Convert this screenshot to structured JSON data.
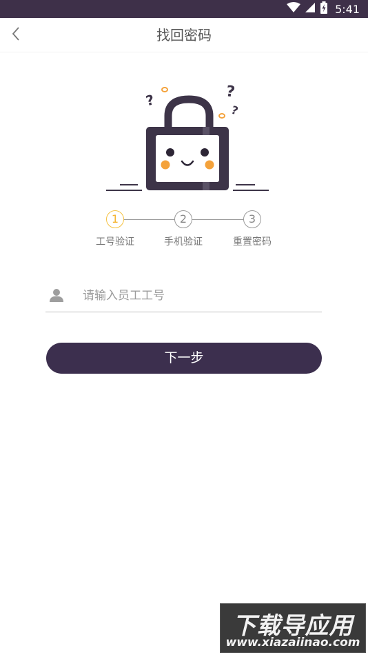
{
  "status_bar": {
    "time": "5:41"
  },
  "header": {
    "title": "找回密码"
  },
  "steps": [
    {
      "number": "1",
      "label": "工号验证"
    },
    {
      "number": "2",
      "label": "手机验证"
    },
    {
      "number": "3",
      "label": "重置密码"
    }
  ],
  "form": {
    "employee_id_placeholder": "请输入员工工号",
    "employee_id_value": ""
  },
  "next_button": {
    "label": "下一步"
  },
  "watermark": {
    "title": "下载导应用",
    "url": "www.xiazaiinao.com"
  },
  "colors": {
    "status_bar": "#3e3049",
    "primary_button": "#3c2f4e",
    "active_step": "#f5c242",
    "lock_body": "#3d3448",
    "cheek": "#f4a23b"
  }
}
